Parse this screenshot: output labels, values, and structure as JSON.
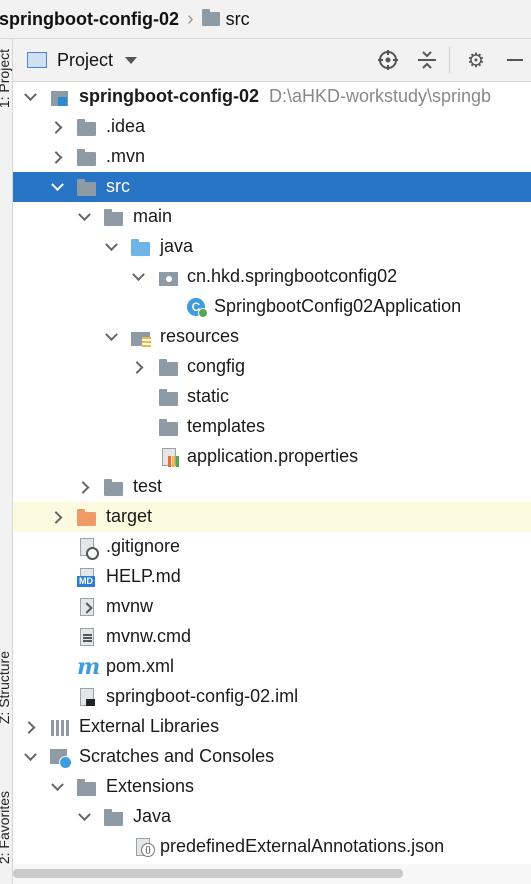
{
  "breadcrumb": {
    "project": "springboot-config-02",
    "folder": "src"
  },
  "side_tabs": {
    "project": "1: Project",
    "structure": "Z: Structure",
    "favorites": "2: Favorites"
  },
  "header": {
    "title": "Project",
    "icons": [
      "locate-icon",
      "collapse-all-icon",
      "gear-icon",
      "minimize-icon"
    ]
  },
  "tree": {
    "root": {
      "name": "springboot-config-02",
      "path": "D:\\aHKD-workstudy\\springb"
    },
    "idea": ".idea",
    "mvn": ".mvn",
    "src": "src",
    "main": "main",
    "java": "java",
    "package": "cn.hkd.springbootconfig02",
    "app_class": "SpringbootConfig02Application",
    "resources": "resources",
    "congfig": "congfig",
    "static": "static",
    "templates": "templates",
    "app_props": "application.properties",
    "test": "test",
    "target": "target",
    "gitignore": ".gitignore",
    "help": "HELP.md",
    "mvnw": "mvnw",
    "mvnw_cmd": "mvnw.cmd",
    "pom": "pom.xml",
    "iml": "springboot-config-02.iml",
    "external_libraries": "External Libraries",
    "scratches": "Scratches and Consoles",
    "extensions": "Extensions",
    "java_ext": "Java",
    "annotations_json": "predefinedExternalAnnotations.json"
  },
  "colors": {
    "selection": "#2874c5",
    "excluded_row": "#fcfadf",
    "folder": "#8f9ba4",
    "source_folder": "#6db5e6",
    "target_folder": "#f09b66"
  }
}
